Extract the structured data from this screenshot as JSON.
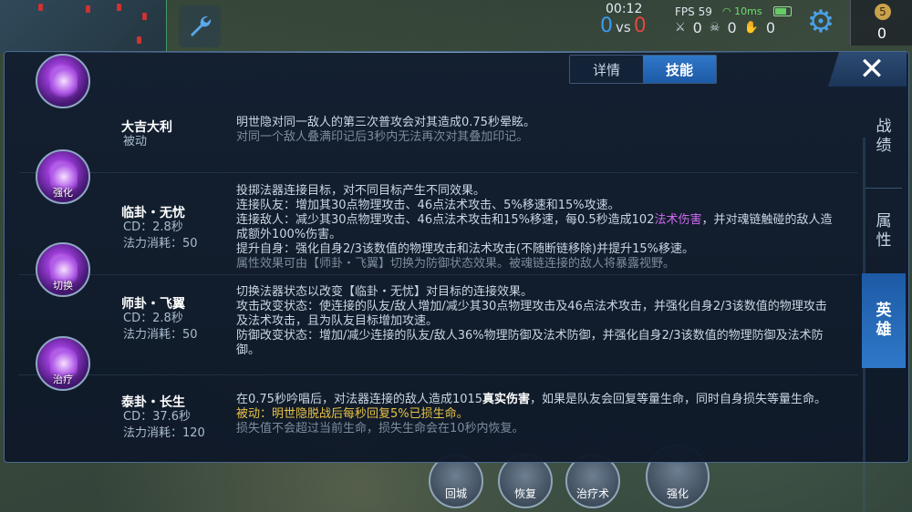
{
  "hud": {
    "time": "00:12",
    "score_blue": "0",
    "vs": "vs",
    "score_red": "0",
    "fps": "FPS 59",
    "ping": "10ms",
    "kills": "0",
    "deaths": "0",
    "assists": "0",
    "gold_label": "5",
    "gold": "0"
  },
  "tabs": [
    {
      "label": "详情",
      "active": false
    },
    {
      "label": "技能",
      "active": true
    }
  ],
  "side_tabs": [
    {
      "label": "战\n绩",
      "active": false
    },
    {
      "label": "属\n性",
      "active": false
    },
    {
      "label": "英\n雄",
      "active": true
    }
  ],
  "close_label": "✕",
  "bottom_skills": [
    "回城",
    "恢复",
    "治疗术",
    "强化"
  ],
  "skills": [
    {
      "name": "大吉大利",
      "info1": "被动",
      "info2": "",
      "icon_tag": "",
      "icon_name": "ghost-figure-icon",
      "lines": [
        {
          "text": "明世隐对同一敌人的第三次普攻会对其造成0.75秒晕眩。",
          "cls": ""
        },
        {
          "text": "对同一个敌人叠满印记后3秒内无法再次对其叠加印记。",
          "cls": "dim"
        }
      ]
    },
    {
      "name": "临卦・无忧",
      "info1": "CD：2.8秒",
      "info2": "法力消耗：50",
      "icon_tag": "强化",
      "icon_name": "chain-link-icon",
      "lines": [
        {
          "text": "投掷法器连接目标，对不同目标产生不同效果。",
          "cls": ""
        },
        {
          "text": "连接队友：增加其30点物理攻击、46点法术攻击、5%移速和15%攻速。",
          "cls": ""
        },
        {
          "text": "连接敌人：减少其30点物理攻击、46点法术攻击和15%移速，每0.5秒造成102",
          "cls": "",
          "magic": "法术伤害",
          "tail": "，并对魂链触碰的敌人造"
        },
        {
          "text": "成额外100%伤害。",
          "cls": ""
        },
        {
          "text": "提升自身：强化自身2/3该数值的物理攻击和法术攻击(不随断链移除)并提升15%移速。",
          "cls": ""
        },
        {
          "text": "属性效果可由【师卦・飞翼】切换为防御状态效果。被魂链连接的敌人将暴露视野。",
          "cls": "dim"
        }
      ]
    },
    {
      "name": "师卦・飞翼",
      "info1": "CD：2.8秒",
      "info2": "法力消耗：50",
      "icon_tag": "切换",
      "icon_name": "swap-mode-icon",
      "lines": [
        {
          "text": "切换法器状态以改变【临卦・无忧】对目标的连接效果。",
          "cls": ""
        },
        {
          "text": "攻击改变状态：使连接的队友/敌人增加/减少其30点物理攻击及46点法术攻击，并强化自身2/3该数值的物理攻击",
          "cls": ""
        },
        {
          "text": "及法术攻击，且为队友目标增加攻速。",
          "cls": ""
        },
        {
          "text": "防御改变状态：增加/减少连接的队友/敌人36%物理防御及法术防御，并强化自身2/3该数值的物理防御及法术防",
          "cls": ""
        },
        {
          "text": "御。",
          "cls": ""
        }
      ]
    },
    {
      "name": "泰卦・长生",
      "info1": "CD：37.6秒",
      "info2": "法力消耗：120",
      "icon_tag": "治疗",
      "icon_name": "healer-portrait-icon",
      "lines": [
        {
          "text": "在0.75秒吟唱后，对法器连接的敌人造成1015",
          "cls": "",
          "truedmg": "真实伤害",
          "tail": "，如果是队友会回复等量生命，同时自身损失等量生命。"
        },
        {
          "text": "被动：明世隐脱战后每秒回复5%已损生命。",
          "cls": "passive"
        },
        {
          "text": "损失值不会超过当前生命，损失生命会在10秒内恢复。",
          "cls": "dim"
        }
      ]
    }
  ]
}
